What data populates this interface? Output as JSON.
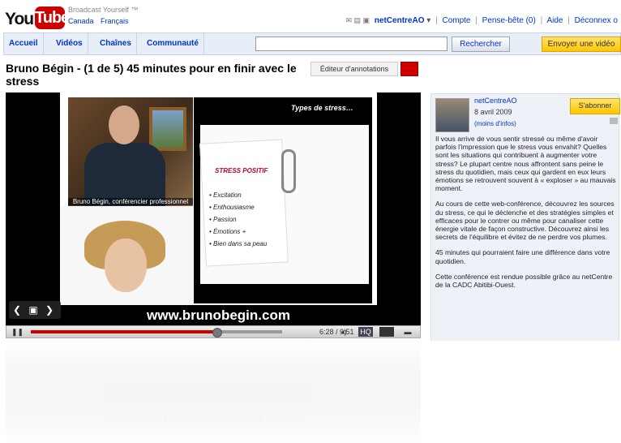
{
  "header": {
    "logo_text_left": "You",
    "logo_text_right": "Tube",
    "tagline": "Broadcast Yourself ™",
    "region": [
      "Canada",
      "Français"
    ],
    "user": "netCentreAO",
    "links": [
      "Compte",
      "Pense-bête (0)",
      "Aide",
      "Déconnex o"
    ]
  },
  "nav": {
    "tabs": [
      "Accueil",
      "Vidéos",
      "Chaînes",
      "Communauté"
    ],
    "search_placeholder": "",
    "search_button": "Rechercher",
    "upload_button": "Envoyer une vidéo"
  },
  "video": {
    "title": "Bruno Bégin - (1 de 5) 45 minutes pour en finir avec le stress",
    "annotations_button": "Éditeur d'annotations",
    "caption": "Bruno Bégin, conférencier professionnel",
    "slide_title": "Types de stress…",
    "card_title": "STRESS POSITIF",
    "card_items": [
      "• Excitation",
      "• Enthousiasme",
      "• Passion",
      "• Émotions +",
      "• Bien dans sa peau"
    ],
    "website": "www.brunobegin.com",
    "time": "6:28 / 9:51",
    "progress": 0.74
  },
  "sidebar": {
    "channel": "netCentreAO",
    "date": "8 avril 2009",
    "more": "(moins d'infos)",
    "subscribe": "S'abonner",
    "description": [
      "Il vous arrive de vous sentir stressé ou même d'avoir parfois l'impression que le stress vous envahit? Quelles sont les situations qui contribuent à augmenter votre stress? Le plupart centre nous affrontent sans peine le stress du quotidien, mais ceux qui gardent en eux leurs émotions se retrouvent souvent à « exploser » au mauvais moment.",
      "Au cours de cette web-conférence, découvrez les sources du stress, ce qui le déclenche et des stratégies simples et efficaces pour le contrer ou même pour canaliser cette énergie vitale de façon constructive. Découvrez ainsi les secrets de l'équilibre et évitez de ne perdre vos plumes.",
      "45 minutes qui pourraient faire une différence dans votre quotidien.",
      "Cette conférence est rendue possible grâce au netCentre de la CADC Abitibi-Ouest."
    ]
  },
  "colors": {
    "brand_red": "#cc0000",
    "link_blue": "#0033cc",
    "subscribe_yellow": "#ffc600"
  }
}
